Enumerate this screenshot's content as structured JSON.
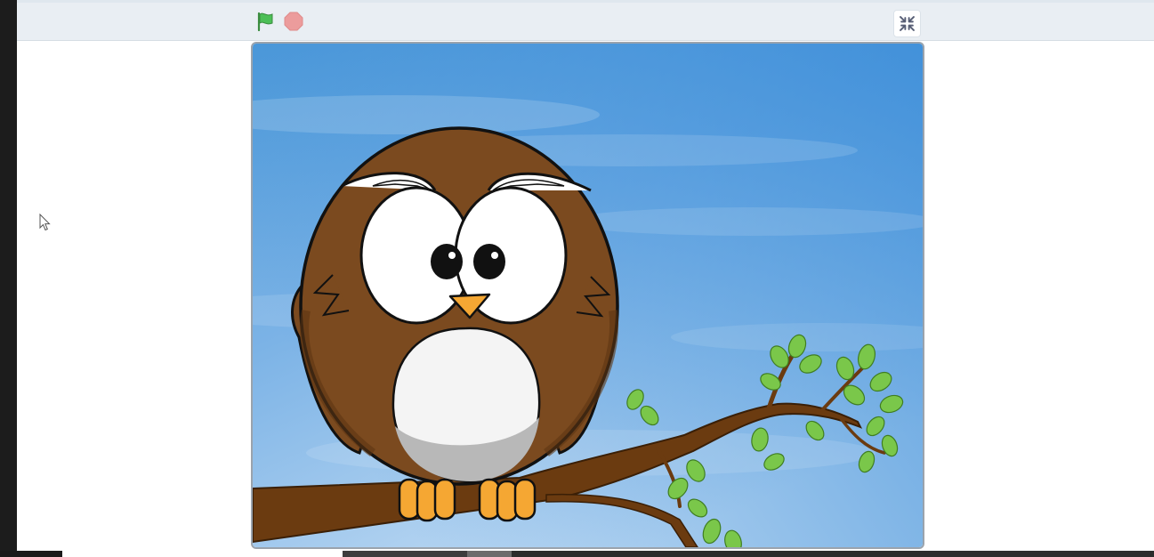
{
  "window": {
    "title": ""
  },
  "toolbar": {
    "green_flag": {
      "icon": "green-flag-icon",
      "color": "#4cbf56"
    },
    "stop": {
      "icon": "stop-icon",
      "color": "#ec9c9c"
    },
    "unfullscreen": {
      "icon": "unfullscreen-icon"
    }
  },
  "stage": {
    "sprites": [
      "owl",
      "tree-branch"
    ],
    "backdrop": "blue-sky",
    "colors": {
      "sky_top": "#4a97d8",
      "sky_bottom": "#b9d6f3",
      "owl_brown": "#7b4a1f",
      "branch_brown": "#6b3b10",
      "leaf_green": "#7ac74a",
      "beak_orange": "#f5a733"
    }
  }
}
